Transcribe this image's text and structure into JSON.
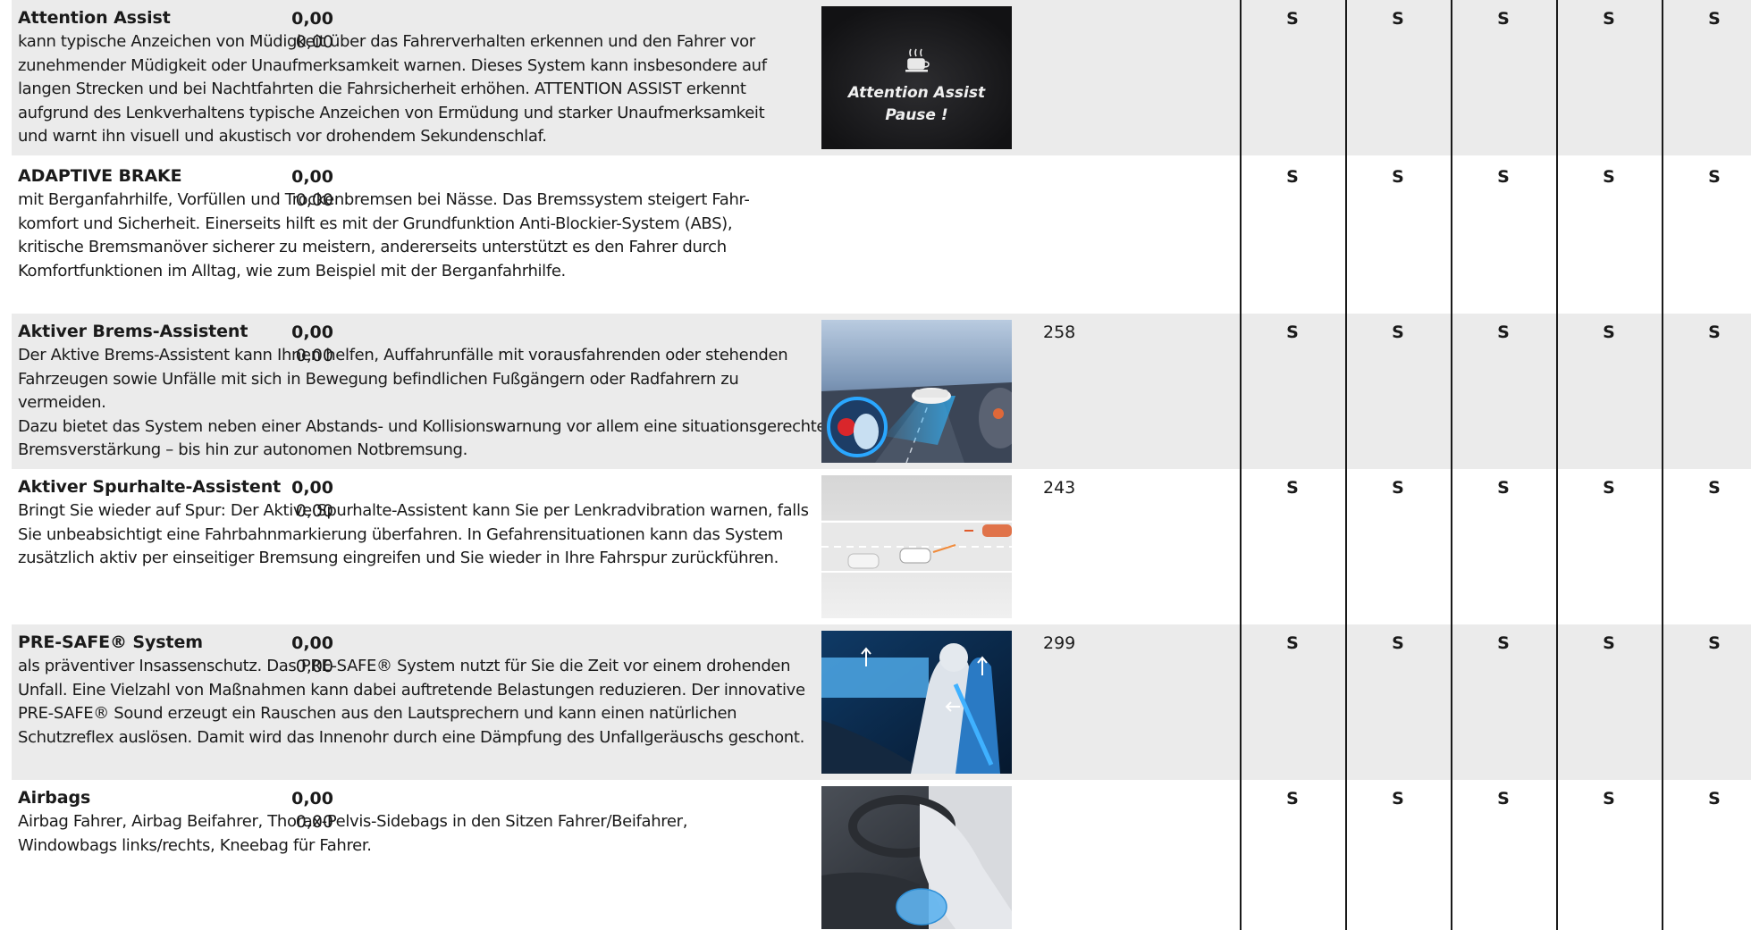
{
  "rows": [
    {
      "title": "Attention Assist",
      "desc": "kann typische Anzeichen von Müdigkeit über das Fahrerverhalten erkennen und den Fahrer vor\nzunehmender Müdigkeit oder Unaufmerksamkeit warnen. Dieses System kann insbesondere auf\nlangen Strecken und bei Nachtfahrten die Fahrsicherheit erhöhen. ATTENTION ASSIST erkennt\naufgrund des Lenkverhaltens typische Anzeichen von Ermüdung und starker Unaufmerksamkeit\nund warnt ihn visuell und akustisch vor drohendem Sekundenschlaf.",
      "image_text_1": "Attention Assist",
      "image_text_2": "Pause !",
      "code": "",
      "price_bold": "0,00",
      "price": "0,00",
      "std": [
        "S",
        "S",
        "S",
        "S",
        "S"
      ]
    },
    {
      "title": "ADAPTIVE BRAKE",
      "desc": "mit Berganfahrhilfe, Vorfüllen und Trockenbremsen bei Nässe. Das Bremssystem steigert Fahr-\nkomfort und Sicherheit. Einerseits hilft es mit der Grundfunktion Anti-Blockier-System (ABS),\nkritische Bremsmanöver sicherer zu meistern, andererseits unterstützt es den Fahrer durch\nKomfortfunktionen im Alltag, wie zum Beispiel mit der Berganfahrhilfe.",
      "code": "",
      "price_bold": "0,00",
      "price": "0,00",
      "std": [
        "S",
        "S",
        "S",
        "S",
        "S"
      ]
    },
    {
      "title": "Aktiver Brems-Assistent",
      "desc": "Der Aktive Brems-Assistent kann Ihnen helfen, Auffahrunfälle mit vorausfahrenden oder stehenden\nFahrzeugen sowie Unfälle mit sich in Bewegung befindlichen Fußgängern oder Radfahrern zu vermeiden.\nDazu bietet das System neben einer Abstands- und Kollisionswarnung vor allem eine situationsgerechte\nBremsverstärkung – bis hin zur autonomen Notbremsung.",
      "code": "258",
      "price_bold": "0,00",
      "price": "0,00",
      "std": [
        "S",
        "S",
        "S",
        "S",
        "S"
      ]
    },
    {
      "title": "Aktiver Spurhalte-Assistent",
      "desc": "Bringt Sie wieder auf Spur: Der Aktive Spurhalte-Assistent kann Sie per Lenkradvibration warnen, falls\nSie unbeabsichtigt eine Fahrbahnmarkierung überfahren. In Gefahrensituationen kann das System\nzusätzlich aktiv per einseitiger Bremsung eingreifen und Sie wieder in Ihre Fahrspur zurückführen.",
      "code": "243",
      "price_bold": "0,00",
      "price": "0,00",
      "std": [
        "S",
        "S",
        "S",
        "S",
        "S"
      ]
    },
    {
      "title": "PRE-SAFE® System",
      "desc": "als präventiver Insassenschutz. Das PRE-SAFE® System nutzt für Sie die Zeit vor einem drohenden\nUnfall. Eine Vielzahl von Maßnahmen kann dabei auftretende Belastungen reduzieren. Der innovative\nPRE-SAFE® Sound erzeugt ein Rauschen aus den Lautsprechern und kann einen natürlichen\nSchutzreflex auslösen. Damit wird das Innenohr durch eine Dämpfung des Unfallgeräuschs geschont.",
      "code": "299",
      "price_bold": "0,00",
      "price": "0,00",
      "std": [
        "S",
        "S",
        "S",
        "S",
        "S"
      ]
    },
    {
      "title": "Airbags",
      "desc": "Airbag Fahrer, Airbag Beifahrer, Thorax-Pelvis-Sidebags in den Sitzen Fahrer/Beifahrer,\nWindowbags links/rechts, Kneebag für Fahrer.",
      "code": "",
      "price_bold": "0,00",
      "price": "0,00",
      "std": [
        "S",
        "S",
        "S",
        "S",
        "S"
      ]
    }
  ]
}
